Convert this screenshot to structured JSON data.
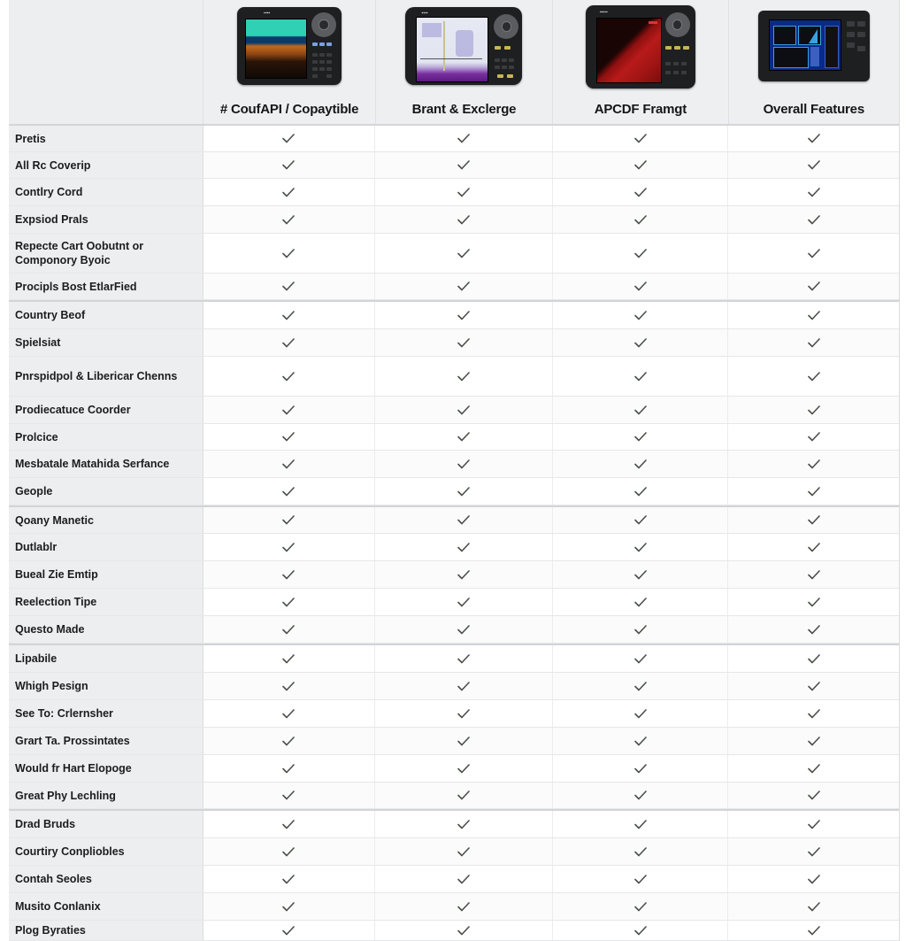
{
  "table": {
    "columns": [
      {
        "name": "# CoufAPI / Copaytible",
        "device_icon": "fishfinder-sonar-device-icon",
        "screen_colors": [
          "#2fd0b4",
          "#0b3a6a",
          "#c46a1c",
          "#120a05"
        ]
      },
      {
        "name": "Brant & Exclerge",
        "device_icon": "gps-chartplotter-device-icon",
        "screen_colors": [
          "#e6e8f2",
          "#a9a6d8",
          "#7a2fa0"
        ]
      },
      {
        "name": "APCDF Framgt",
        "device_icon": "radar-device-icon",
        "screen_colors": [
          "#1a0505",
          "#b81a1a"
        ]
      },
      {
        "name": "Overall Features",
        "device_icon": "multifunction-display-device-icon",
        "screen_colors": [
          "#0a2a8a",
          "#3aa0e0",
          "#0d0d14"
        ]
      }
    ],
    "check_icon": "checkmark-icon",
    "check_color": "#4a4f4a",
    "rows": [
      {
        "label": "Pretis",
        "values": [
          true,
          true,
          true,
          true
        ]
      },
      {
        "label": "All Rc Coverip",
        "values": [
          true,
          true,
          true,
          true
        ]
      },
      {
        "label": "Contlry Cord",
        "values": [
          true,
          true,
          true,
          true
        ]
      },
      {
        "label": "Expsiod Prals",
        "values": [
          true,
          true,
          true,
          true
        ]
      },
      {
        "label": "Repecte Cart Oobutnt or Componory Byoic",
        "values": [
          true,
          true,
          true,
          true
        ]
      },
      {
        "label": "Procipls Bost EtlarFied",
        "values": [
          true,
          true,
          true,
          true
        ]
      },
      {
        "label": "Country Beof",
        "values": [
          true,
          true,
          true,
          true
        ]
      },
      {
        "label": "Spielsiat",
        "values": [
          true,
          true,
          true,
          true
        ]
      },
      {
        "label": "Pnrspidpol & Libericar Chenns",
        "values": [
          true,
          true,
          true,
          true
        ]
      },
      {
        "label": "Prodiecatuce Coorder",
        "values": [
          true,
          true,
          true,
          true
        ]
      },
      {
        "label": "Prolcice",
        "values": [
          true,
          true,
          true,
          true
        ]
      },
      {
        "label": "Mesbatale Matahida Serfance",
        "values": [
          true,
          true,
          true,
          true
        ]
      },
      {
        "label": "Geople",
        "values": [
          true,
          true,
          true,
          true
        ]
      },
      {
        "label": "Qoany Manetic",
        "values": [
          true,
          true,
          true,
          true
        ]
      },
      {
        "label": "Dutlablr",
        "values": [
          true,
          true,
          true,
          true
        ]
      },
      {
        "label": "Bueal Zie Emtip",
        "values": [
          true,
          true,
          true,
          true
        ]
      },
      {
        "label": "Reelection Tipe",
        "values": [
          true,
          true,
          true,
          true
        ]
      },
      {
        "label": "Questo Made",
        "values": [
          true,
          true,
          true,
          true
        ]
      },
      {
        "label": "Lipabile",
        "values": [
          true,
          true,
          true,
          true
        ]
      },
      {
        "label": "Whigh Pesign",
        "values": [
          true,
          true,
          true,
          true
        ]
      },
      {
        "label": "See To: Crlernsher",
        "values": [
          true,
          true,
          true,
          true
        ]
      },
      {
        "label": "Grart Ta. Prossintates",
        "values": [
          true,
          true,
          true,
          true
        ]
      },
      {
        "label": "Would fr Hart Elopoge",
        "values": [
          true,
          true,
          true,
          true
        ]
      },
      {
        "label": "Great Phy Lechling",
        "values": [
          true,
          true,
          true,
          true
        ]
      },
      {
        "label": "Drad Bruds",
        "values": [
          true,
          true,
          true,
          true
        ]
      },
      {
        "label": "Courtiry Conpliobles",
        "values": [
          true,
          true,
          true,
          true
        ]
      },
      {
        "label": "Contah Seoles",
        "values": [
          true,
          true,
          true,
          true
        ]
      },
      {
        "label": "Musito Conlanix",
        "values": [
          true,
          true,
          true,
          true
        ]
      },
      {
        "label": "Plog Byraties",
        "values": [
          true,
          true,
          true,
          true
        ]
      }
    ]
  }
}
